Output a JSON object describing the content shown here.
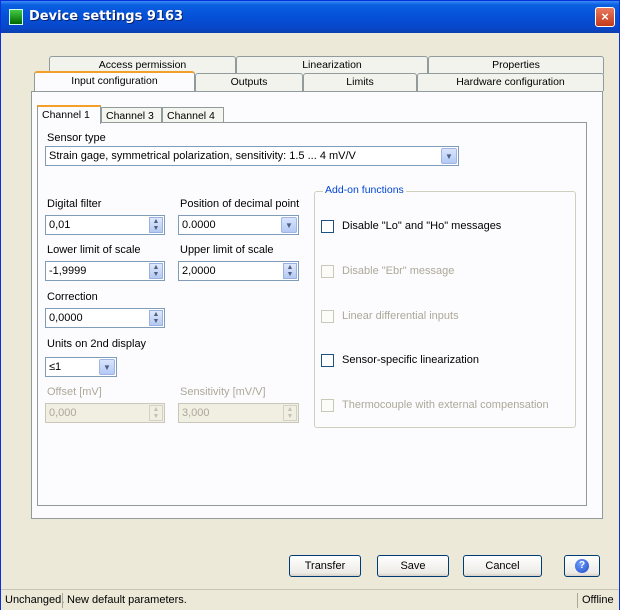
{
  "window": {
    "title": "Device settings 9163",
    "close_glyph": "×"
  },
  "tabs_back": [
    "Access permission",
    "Linearization",
    "Properties"
  ],
  "tabs_front": [
    "Input configuration",
    "Outputs",
    "Limits",
    "Hardware configuration"
  ],
  "channel_tabs": [
    "Channel 1",
    "Channel 3",
    "Channel 4"
  ],
  "sensor": {
    "label": "Sensor type",
    "value": "Strain gage, symmetrical polarization, sensitivity: 1.5 ... 4 mV/V"
  },
  "fields": {
    "digital_filter": {
      "label": "Digital filter",
      "value": "0,01"
    },
    "decimal_point": {
      "label": "Position of decimal point",
      "value": "0.0000"
    },
    "lower_limit": {
      "label": "Lower limit of scale",
      "value": "-1,9999"
    },
    "upper_limit": {
      "label": "Upper limit of scale",
      "value": "2,0000"
    },
    "correction": {
      "label": "Correction",
      "value": "0,0000"
    },
    "units_2nd": {
      "label": "Units on 2nd display",
      "value": "≤1"
    },
    "offset": {
      "label": "Offset [mV]",
      "value": "0,000"
    },
    "sensitivity": {
      "label": "Sensitivity [mV/V]",
      "value": "3,000"
    }
  },
  "addon": {
    "title": "Add-on functions",
    "items": [
      "Disable \"Lo\" and \"Hо\" messages",
      "Disable \"Ebr\" message",
      "Linear differential inputs",
      "Sensor-specific linearization",
      "Thermocouple with external compensation"
    ]
  },
  "buttons": {
    "transfer": "Transfer",
    "save": "Save",
    "cancel": "Cancel",
    "help": "?"
  },
  "status": {
    "state": "Unchanged.",
    "message": "New default parameters.",
    "connection": "Offline"
  },
  "icons": {
    "spin_up": "▲",
    "spin_down": "▼",
    "dropdown": "▼"
  },
  "colors": {
    "accent": "#f2a02a",
    "titlebar": "#0550d8",
    "group_title": "#0046d5"
  }
}
